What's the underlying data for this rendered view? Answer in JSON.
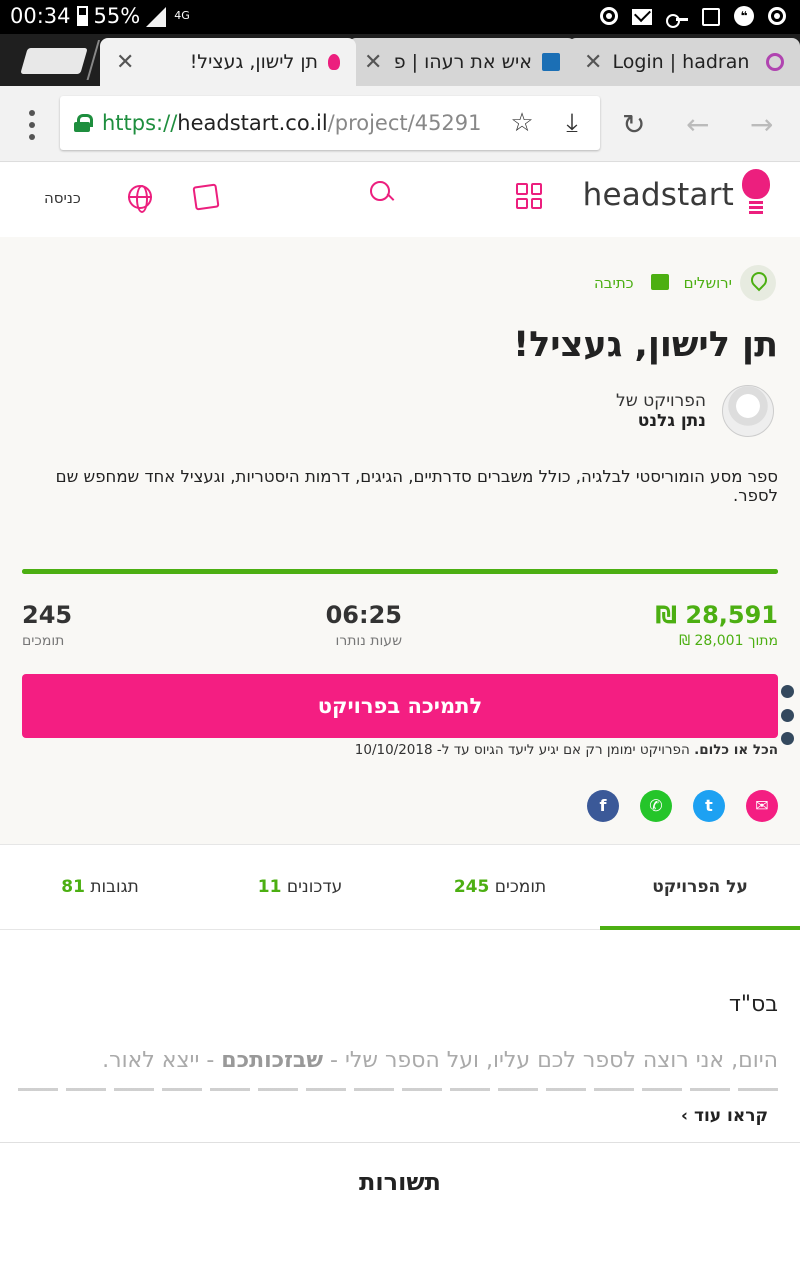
{
  "status_bar": {
    "time": "00:34",
    "battery": "55%",
    "network": "4G"
  },
  "browser": {
    "tabs": [
      {
        "title": "תן לישון, געציל!",
        "active": true
      },
      {
        "title": "איש את רעהו | פרו",
        "active": false
      },
      {
        "title": "Login | hadran - b",
        "active": false
      }
    ],
    "url": {
      "scheme": "https://",
      "host": "headstart.co.il",
      "path": "/project/45291"
    }
  },
  "site": {
    "logo_text": "headstart",
    "login_label": "כניסה",
    "brand_color": "#ec1f7e",
    "accent_color": "#4caf12"
  },
  "project": {
    "location": "ירושלים",
    "category": "כתיבה",
    "title": "תן לישון, געציל!",
    "owner_label": "הפרויקט של",
    "owner_name": "נתן גלנט",
    "description": "ספר מסע הומוריסטי לבלגיה, כולל משברים סדרתיים, הגיגים, דרמות היסטריות, וגעציל אחד שמחפש שם לספר.",
    "raised": "28,591 ₪",
    "goal": "מתוך 28,001 ₪",
    "progress_percent": 100,
    "hours_left": "06:25",
    "hours_label": "שעות נותרו",
    "backers": "245",
    "backers_label": "תומכים",
    "support_button": "לתמיכה בפרויקט",
    "all_or_nothing_bold": "הכל או כלום.",
    "all_or_nothing_text": " הפרויקט ימומן רק אם יגיע ליעד הגיוס עד ל- 10/10/2018"
  },
  "tabs": [
    {
      "label": "על הפרויקט",
      "count": ""
    },
    {
      "label": "תומכים",
      "count": "245"
    },
    {
      "label": "עדכונים",
      "count": "11"
    },
    {
      "label": "תגובות",
      "count": "81"
    }
  ],
  "content": {
    "heading": "בס\"ד",
    "para_start": "היום, אני רוצה לספר לכם עליו, ועל הספר שלי - ",
    "para_bold": "שבזכותכם",
    "para_end": " - ייצא לאור.",
    "read_more": "קראו עוד"
  },
  "comments_title": "תשורות"
}
